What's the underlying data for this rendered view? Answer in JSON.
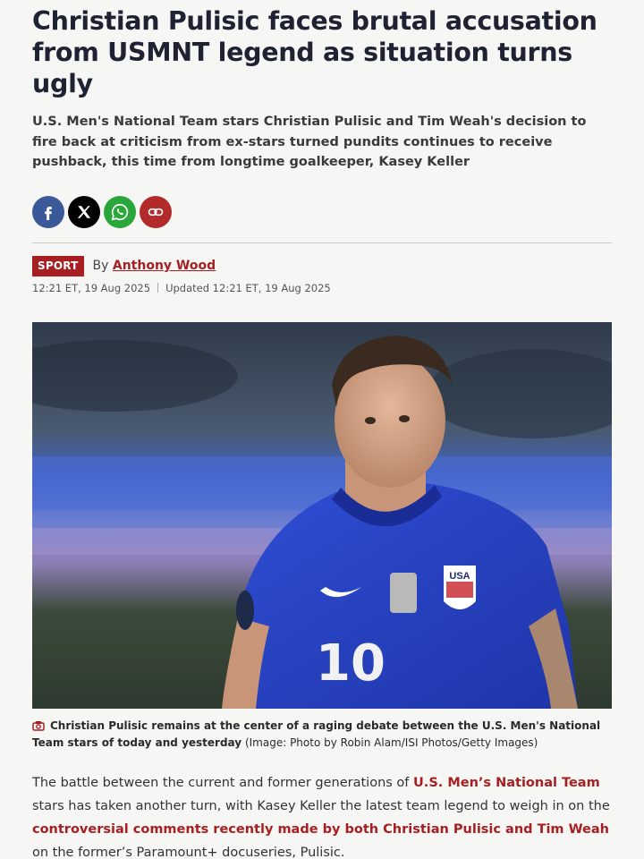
{
  "article": {
    "headline": "Christian Pulisic faces brutal accusation from USMNT legend as situation turns ugly",
    "standfirst": "U.S. Men's National Team stars Christian Pulisic and Tim Weah's decision to fire back at criticism from ex-stars turned pundits continues to receive pushback, this time from longtime goalkeeper, Kasey Keller",
    "section": "SPORT",
    "by_prefix": "By",
    "author": "Anthony Wood",
    "published": "12:21 ET, 19 Aug 2025",
    "updated": "Updated 12:21 ET, 19 Aug 2025"
  },
  "share": {
    "icons": [
      "facebook-icon",
      "x-icon",
      "whatsapp-icon",
      "link-icon"
    ]
  },
  "image": {
    "caption_main": "Christian Pulisic remains at the center of a raging debate between the U.S. Men's National Team stars of today and yesterday",
    "caption_credit": "(Image: Photo by Robin Alam/ISI Photos/Getty Images)",
    "shirt_number": "10",
    "crest_text": "USA"
  },
  "body": {
    "p1_a": "The battle between the current and former generations of ",
    "p1_link1": "U.S. Men’s National Team",
    "p1_b": " stars has taken another turn, with Kasey Keller the latest team legend to weigh in on the ",
    "p1_link2": "controversial comments recently made by both Christian Pulisic and Tim Weah",
    "p1_c": " on the former’s Paramount+ docuseries, Pulisic."
  },
  "colors": {
    "accent": "#a81f22",
    "headline": "#1f2233",
    "facebook": "#3b5998",
    "x": "#000000",
    "whatsapp": "#2aa73a",
    "link": "#b32a2a"
  }
}
